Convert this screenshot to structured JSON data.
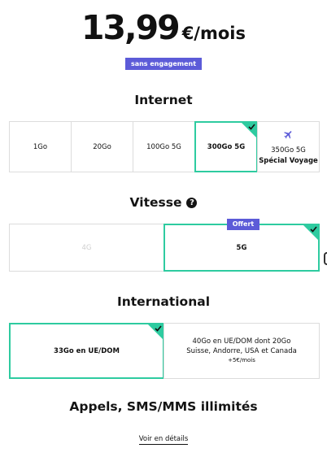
{
  "price": {
    "amount": "13,99",
    "unit": "€/mois"
  },
  "badge": "sans engagement",
  "internet": {
    "title": "Internet",
    "options": [
      {
        "label": "1Go",
        "selected": false
      },
      {
        "label": "20Go",
        "selected": false
      },
      {
        "label": "100Go 5G",
        "selected": false
      },
      {
        "label": "300Go 5G",
        "selected": true
      },
      {
        "label": "350Go 5G",
        "sublabel": "Spécial Voyage",
        "icon": "airplane-icon",
        "selected": false
      }
    ]
  },
  "vitesse": {
    "title": "Vitesse",
    "info_icon": "?",
    "options": [
      {
        "label": "4G",
        "disabled": true
      },
      {
        "label": "5G",
        "selected": true,
        "tag": "Offert"
      }
    ]
  },
  "international": {
    "title": "International",
    "options": [
      {
        "label": "33Go en UE/DOM",
        "selected": true
      },
      {
        "line1": "40Go en UE/DOM dont 20Go",
        "line2": "Suisse, Andorre, USA et Canada",
        "extra": "+5€/mois",
        "selected": false
      }
    ]
  },
  "calls": {
    "title": "Appels, SMS/MMS illimités"
  },
  "details_link": "Voir en détails",
  "colors": {
    "accent_green": "#2ecba0",
    "accent_purple": "#5c5bd8",
    "border": "#dcdcdc"
  }
}
